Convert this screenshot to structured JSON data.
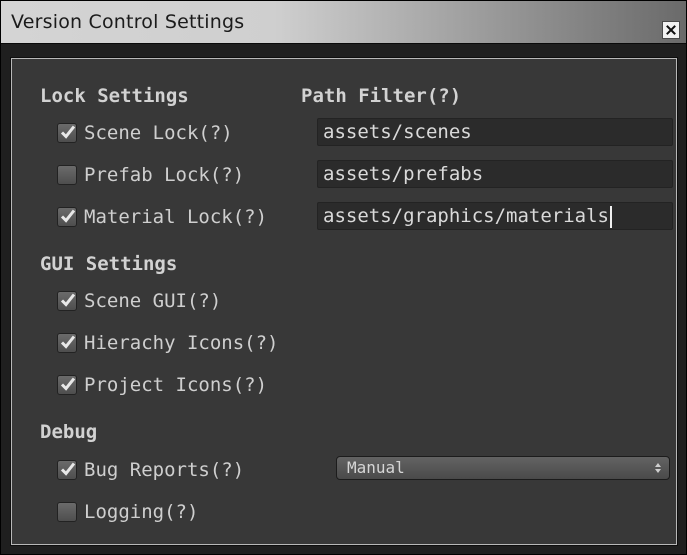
{
  "window": {
    "title": "Version Control Settings",
    "close_icon": "close-icon"
  },
  "lock_settings": {
    "header": "Lock Settings",
    "items": [
      {
        "label": "Scene Lock(?)",
        "checked": true
      },
      {
        "label": "Prefab Lock(?)",
        "checked": false
      },
      {
        "label": "Material Lock(?)",
        "checked": true
      }
    ]
  },
  "path_filter": {
    "header": "Path Filter(?)",
    "fields": [
      {
        "value": "assets/scenes"
      },
      {
        "value": "assets/prefabs"
      },
      {
        "value": "assets/graphics/materials"
      }
    ]
  },
  "gui_settings": {
    "header": "GUI Settings",
    "items": [
      {
        "label": "Scene GUI(?)",
        "checked": true
      },
      {
        "label": "Hierachy Icons(?)",
        "checked": true
      },
      {
        "label": "Project Icons(?)",
        "checked": true
      }
    ]
  },
  "debug": {
    "header": "Debug",
    "items": [
      {
        "label": "Bug Reports(?)",
        "checked": true
      },
      {
        "label": "Logging(?)",
        "checked": false
      }
    ],
    "dropdown": {
      "value": "Manual"
    }
  },
  "colors": {
    "panel_bg": "#383838",
    "text": "#cfcfcf",
    "checkmark": "#e8e8e8"
  }
}
